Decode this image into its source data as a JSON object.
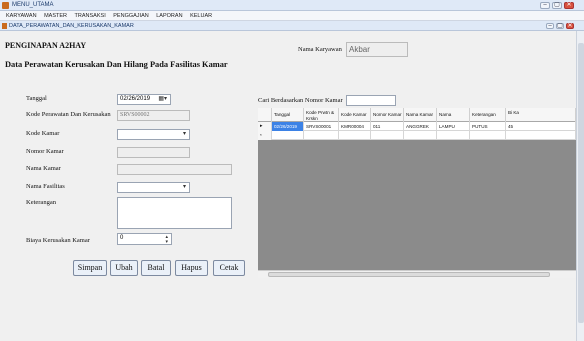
{
  "app": {
    "title": "MENU_UTAMA",
    "menu": [
      "KARYAWAN",
      "MASTER",
      "TRANSAKSI",
      "PENGGAJIAN",
      "LAPORAN",
      "KELUAR"
    ],
    "child_title": "DATA_PERAWATAN_DAN_KERUSAKAN_KAMAR"
  },
  "header": {
    "hotel_name": "PENGINAPAN A2HAY",
    "subtitle": "Data Perawatan Kerusakan Dan Hilang Pada Fasilitas Kamar",
    "employee_label": "Nama Karyawan",
    "employee_value": "Akbar"
  },
  "form": {
    "tanggal_label": "Tanggal",
    "tanggal_value": "02/26/2019",
    "kode_label": "Kode Perawatan Dan Kerusakan",
    "kode_value": "SRVS00002",
    "kode_kamar_label": "Kode Kamar",
    "nomor_kamar_label": "Nomor Kamar",
    "nama_kamar_label": "Nama Kamar",
    "nama_fasilitas_label": "Nama Fasilitas",
    "keterangan_label": "Keterangan",
    "biaya_label": "Biaya Kerusakan Kamar",
    "biaya_value": "0"
  },
  "buttons": {
    "simpan": "Simpan",
    "ubah": "Ubah",
    "batal": "Batal",
    "hapus": "Hapus",
    "cetak": "Cetak"
  },
  "search": {
    "label": "Cari Berdasarkan Nomor Kamar",
    "value": ""
  },
  "grid": {
    "columns": [
      "Tanggal",
      "Kode Prwtn & Krskn",
      "Kode Kamar",
      "Nomor Kamar",
      "Nama Kamar",
      "Nama Fasilitas",
      "Keterangan",
      "Bi Ka"
    ],
    "rows": [
      [
        "02/26/2019",
        "SRVS00001",
        "KMR00004",
        "011",
        "ANGGREK",
        "LAMPU",
        "PUTUS",
        "45"
      ]
    ],
    "new_row_marker": "*",
    "current_row_marker": "▸"
  }
}
